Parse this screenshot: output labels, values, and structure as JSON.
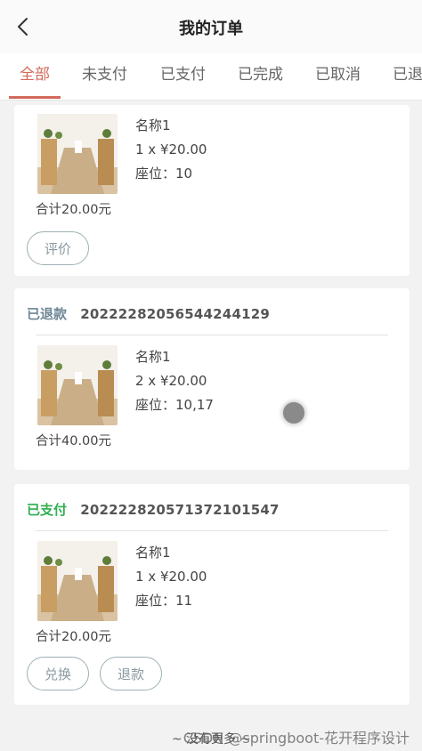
{
  "header": {
    "title": "我的订单"
  },
  "tabs": [
    {
      "label": "全部",
      "active": true
    },
    {
      "label": "未支付",
      "active": false
    },
    {
      "label": "已支付",
      "active": false
    },
    {
      "label": "已完成",
      "active": false
    },
    {
      "label": "已取消",
      "active": false
    },
    {
      "label": "已退",
      "active": false
    }
  ],
  "orders": [
    {
      "status": "",
      "order_no": "",
      "item": {
        "name": "名称1",
        "qty_price": "1 x ¥20.00",
        "seat": "座位：10"
      },
      "subtotal": "合计20.00元",
      "buttons": [
        "评价"
      ]
    },
    {
      "status": "已退款",
      "order_no": "20222282056544244129",
      "item": {
        "name": "名称1",
        "qty_price": "2 x ¥20.00",
        "seat": "座位：10,17"
      },
      "subtotal": "合计40.00元",
      "buttons": []
    },
    {
      "status": "已支付",
      "order_no": "20222282057137210154​7",
      "item": {
        "name": "名称1",
        "qty_price": "1 x ¥20.00",
        "seat": "座位：11"
      },
      "subtotal": "合计20.00元",
      "buttons": [
        "兑换",
        "退款"
      ]
    }
  ],
  "footer_note": "~ 没有更多 ~",
  "watermark": "CSDN @springboot-花开程序设计",
  "colors": {
    "accent": "#d2695a",
    "refunded": "#6e8795",
    "paid": "#2fae50"
  }
}
